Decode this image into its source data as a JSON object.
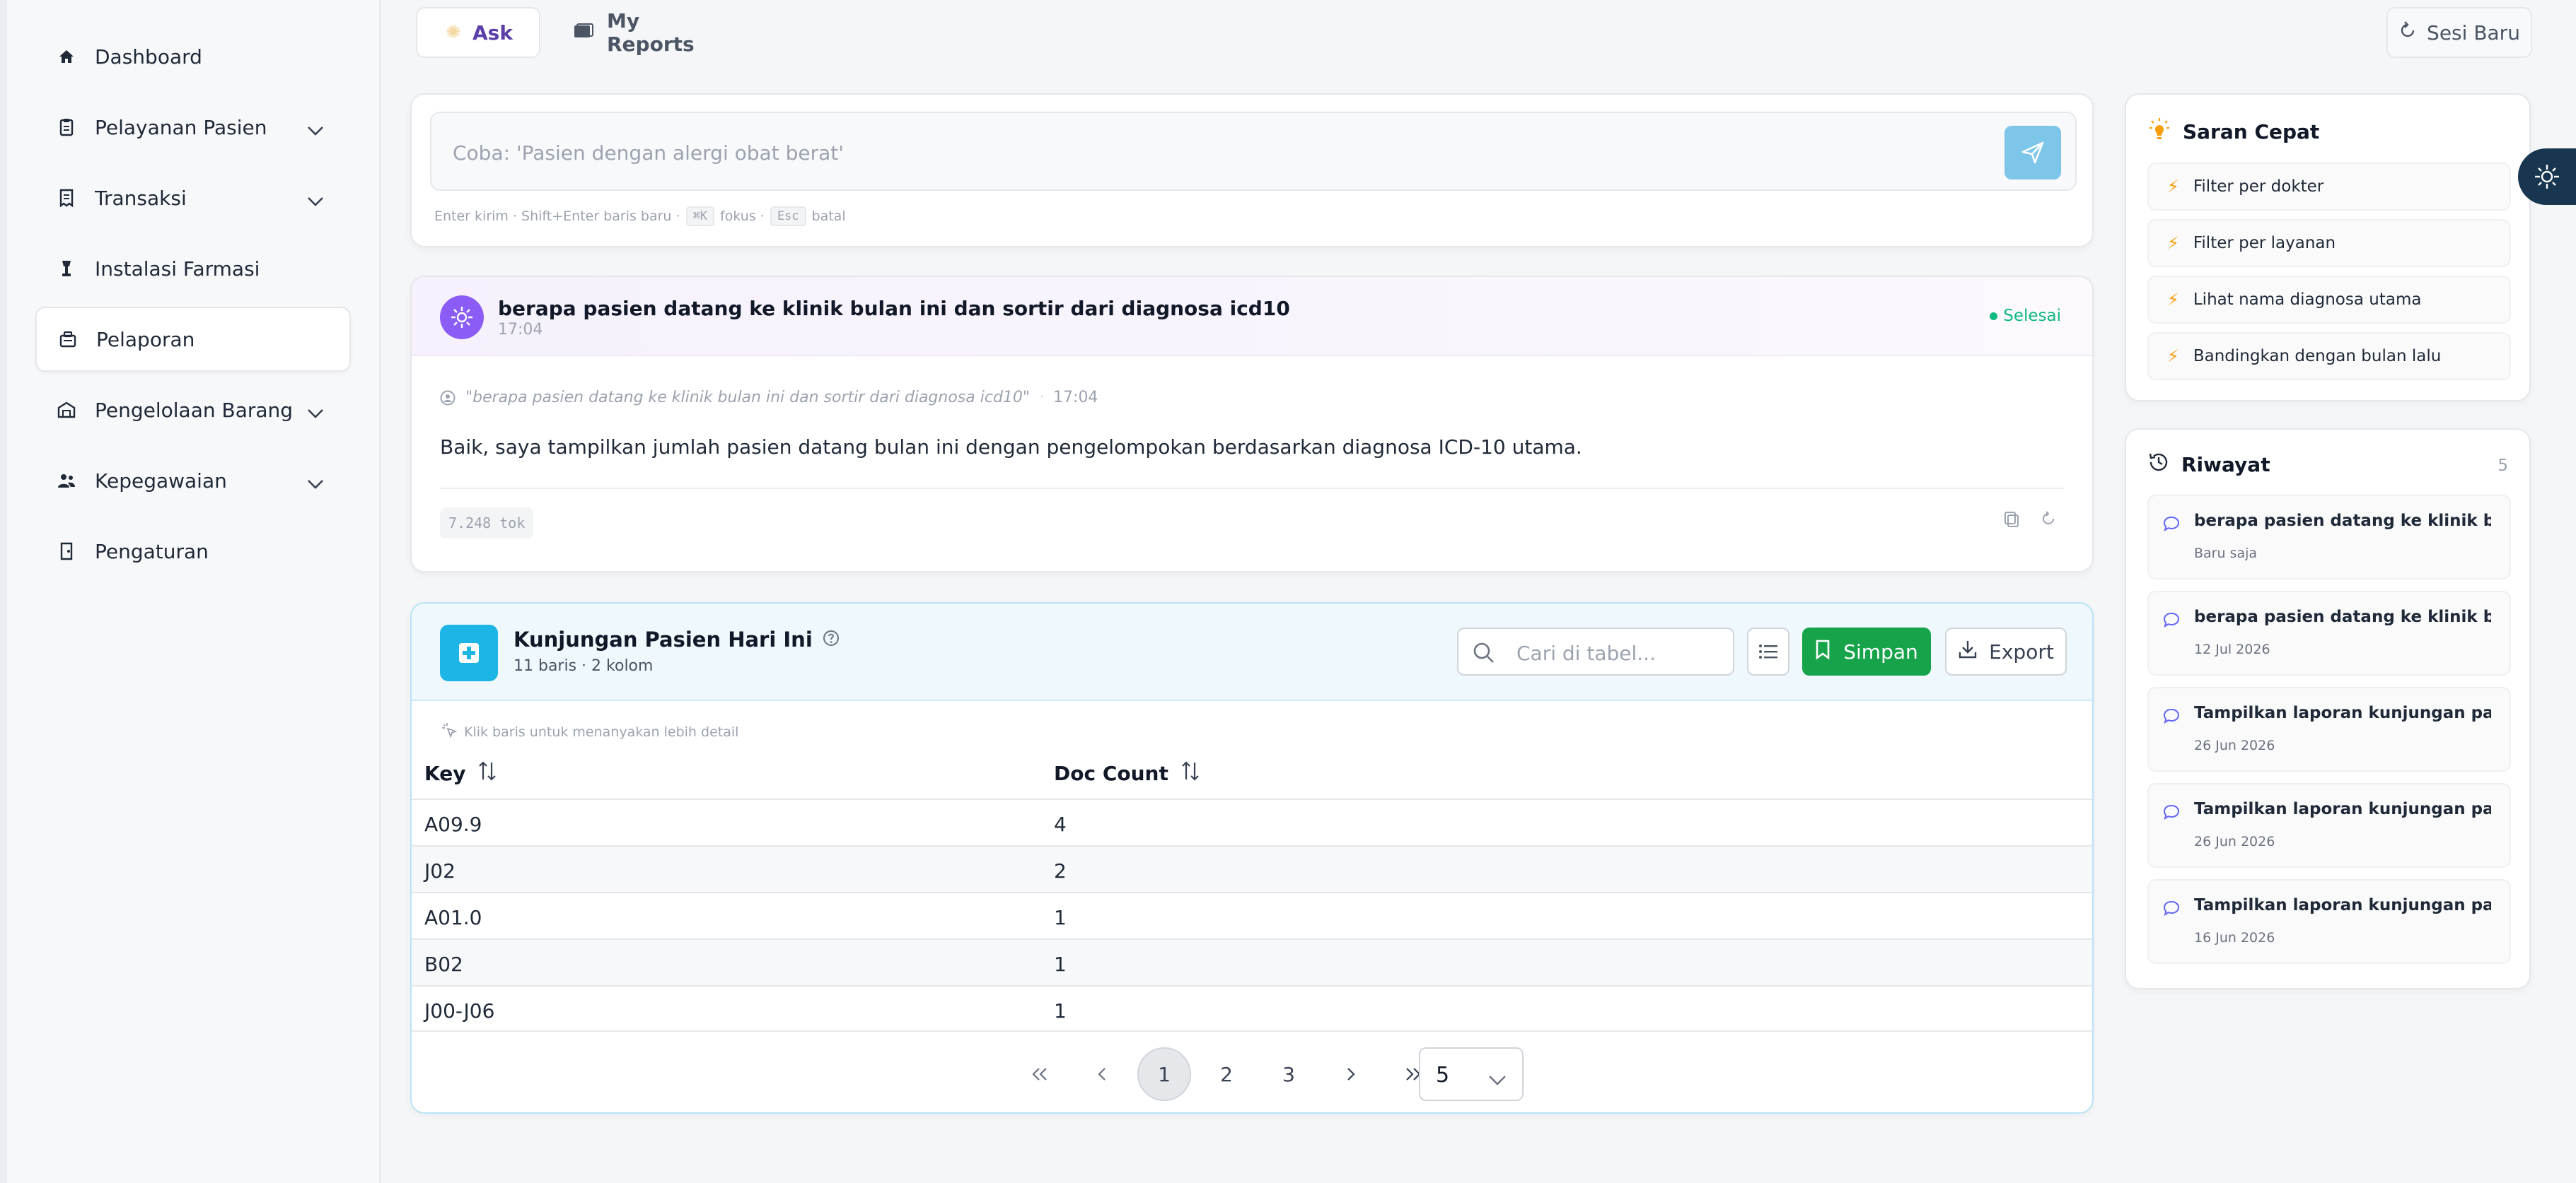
{
  "sidebar": {
    "items": [
      {
        "label": "Dashboard",
        "icon": "home-icon",
        "has_chevron": false,
        "active": false
      },
      {
        "label": "Pelayanan Pasien",
        "icon": "clipboard-icon",
        "has_chevron": true,
        "active": false
      },
      {
        "label": "Transaksi",
        "icon": "receipt-icon",
        "has_chevron": true,
        "active": false
      },
      {
        "label": "Instalasi Farmasi",
        "icon": "pharmacy-icon",
        "has_chevron": false,
        "active": false
      },
      {
        "label": "Pelaporan",
        "icon": "report-icon",
        "has_chevron": false,
        "active": true
      },
      {
        "label": "Pengelolaan Barang",
        "icon": "warehouse-icon",
        "has_chevron": true,
        "active": false
      },
      {
        "label": "Kepegawaian",
        "icon": "staff-icon",
        "has_chevron": true,
        "active": false
      },
      {
        "label": "Pengaturan",
        "icon": "settings-door-icon",
        "has_chevron": false,
        "active": false
      }
    ]
  },
  "topbar": {
    "tabs": [
      {
        "label": "Ask",
        "active": true
      },
      {
        "label": "My Reports",
        "active": false
      }
    ],
    "new_session_label": "Sesi Baru"
  },
  "ask_input": {
    "placeholder": "Coba: 'Pasien dengan alergi obat berat'",
    "hint_send": "Enter kirim · Shift+Enter baris baru ·",
    "kbd_focus": "⌘K",
    "hint_focus": "fokus ·",
    "kbd_cancel": "Esc",
    "hint_cancel": "batal"
  },
  "conversation": {
    "question": "berapa pasien datang ke klinik bulan ini dan sortir dari diagnosa icd10",
    "time": "17:04",
    "status": "Selesai",
    "quote": "\"berapa pasien datang ke klinik bulan ini dan sortir dari diagnosa icd10\"",
    "quote_time": "17:04",
    "answer": "Baik, saya tampilkan jumlah pasien datang bulan ini dengan pengelompokan berdasarkan diagnosa ICD-10 utama.",
    "tokens": "7.248 tok"
  },
  "result_table": {
    "title": "Kunjungan Pasien Hari Ini",
    "subtitle": "11 baris · 2 kolom",
    "search_placeholder": "Cari di tabel...",
    "save_label": "Simpan",
    "export_label": "Export",
    "hint": "Klik baris untuk menanyakan lebih detail",
    "columns": [
      "Key",
      "Doc Count"
    ],
    "rows": [
      [
        "A09.9",
        "4"
      ],
      [
        "J02",
        "2"
      ],
      [
        "A01.0",
        "1"
      ],
      [
        "B02",
        "1"
      ],
      [
        "J00-J06",
        "1"
      ]
    ],
    "pagination": {
      "pages": [
        "1",
        "2",
        "3"
      ],
      "current": "1",
      "page_size": "5"
    }
  },
  "saran_cepat": {
    "title": "Saran Cepat",
    "items": [
      "Filter per dokter",
      "Filter per layanan",
      "Lihat nama diagnosa utama",
      "Bandingkan dengan bulan lalu"
    ]
  },
  "riwayat": {
    "title": "Riwayat",
    "count": "5",
    "items": [
      {
        "title": "berapa pasien datang ke klinik bul...",
        "date": "Baru saja"
      },
      {
        "title": "berapa pasien datang ke klinik bul...",
        "date": "12 Jul 2026"
      },
      {
        "title": "Tampilkan laporan kunjungan pasie...",
        "date": "26 Jun 2026"
      },
      {
        "title": "Tampilkan laporan kunjungan pasie...",
        "date": "26 Jun 2026"
      },
      {
        "title": "Tampilkan laporan kunjungan pasie...",
        "date": "16 Jun 2026"
      }
    ]
  },
  "colors": {
    "accent_purple": "#8b5cf6",
    "send_blue": "#7dc6ea",
    "save_green": "#16a34a",
    "table_icon_blue": "#1db4e6",
    "status_green": "#10b981"
  }
}
